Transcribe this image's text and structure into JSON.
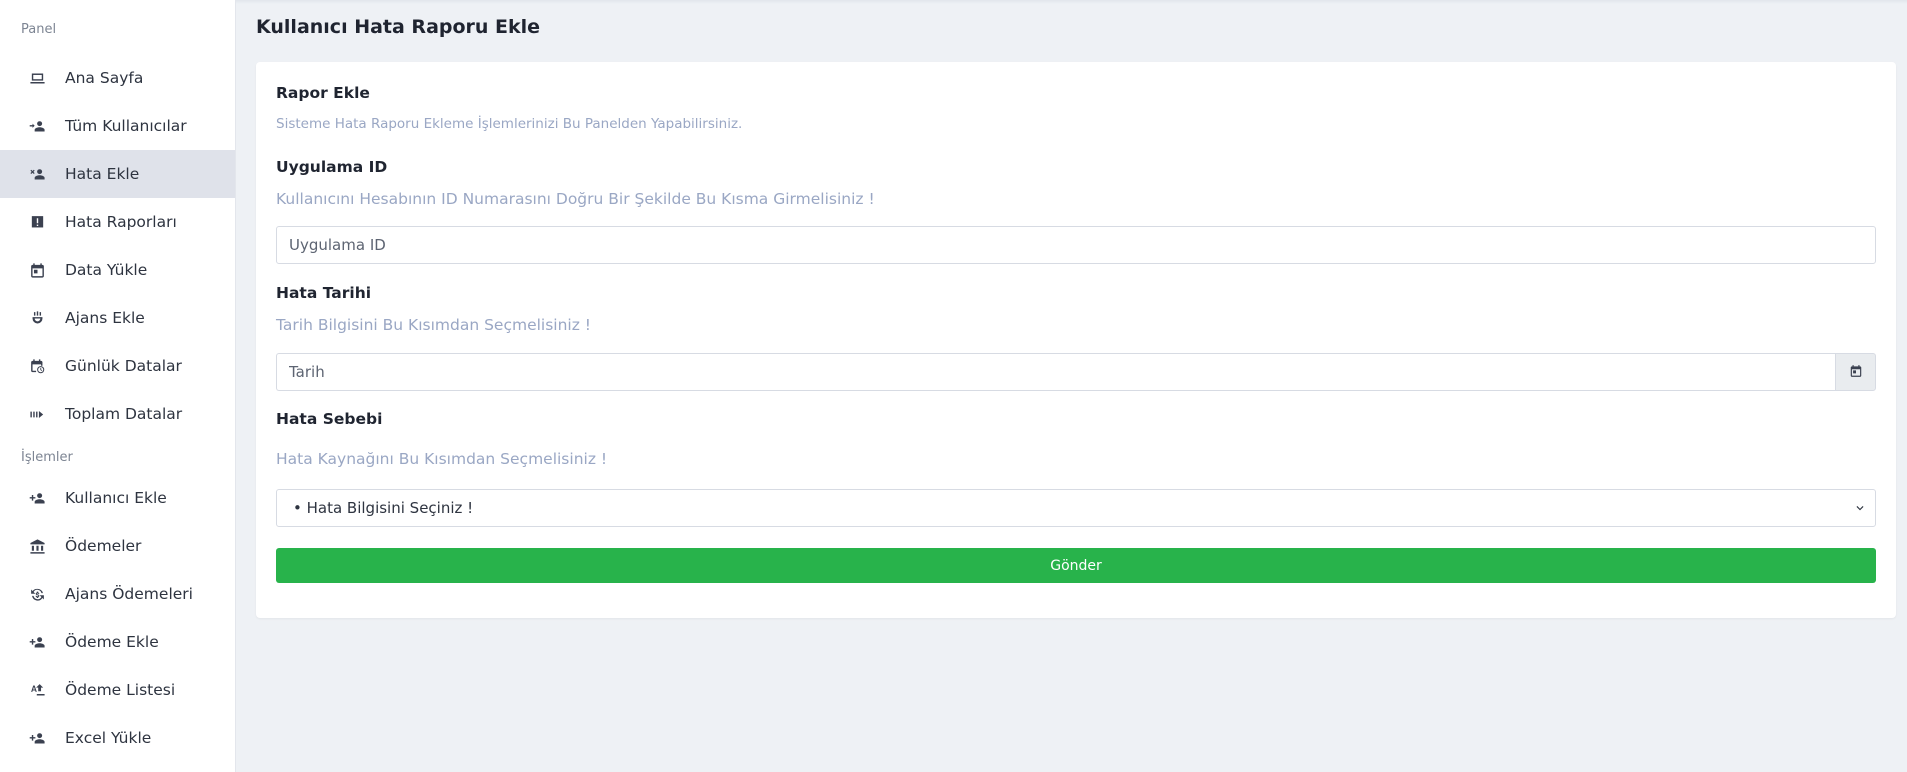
{
  "sidebar": {
    "section_panel": "Panel",
    "section_islemler": "İşlemler",
    "panel_items": [
      {
        "label": "Ana Sayfa",
        "icon": "laptop-icon"
      },
      {
        "label": "Tüm Kullanıcılar",
        "icon": "users-arrow-icon"
      },
      {
        "label": "Hata Ekle",
        "icon": "user-remove-icon",
        "active": true
      },
      {
        "label": "Hata Raporları",
        "icon": "report-icon"
      },
      {
        "label": "Data Yükle",
        "icon": "calendar-icon"
      },
      {
        "label": "Ajans Ekle",
        "icon": "agency-icon"
      },
      {
        "label": "Günlük Datalar",
        "icon": "calendar-clock-icon"
      },
      {
        "label": "Toplam Datalar",
        "icon": "arrow-right-icon"
      }
    ],
    "islem_items": [
      {
        "label": "Kullanıcı Ekle",
        "icon": "user-add-icon"
      },
      {
        "label": "Ödemeler",
        "icon": "bank-icon"
      },
      {
        "label": "Ajans Ödemeleri",
        "icon": "money-cycle-icon"
      },
      {
        "label": "Ödeme Ekle",
        "icon": "user-add-icon"
      },
      {
        "label": "Ödeme Listesi",
        "icon": "text-icon"
      },
      {
        "label": "Excel Yükle",
        "icon": "user-add-icon"
      }
    ]
  },
  "page": {
    "title": "Kullanıcı Hata Raporu Ekle"
  },
  "form": {
    "card_title": "Rapor Ekle",
    "card_subtitle": "Sisteme Hata Raporu Ekleme İşlemlerinizi Bu Panelden Yapabilirsiniz.",
    "app_id_label": "Uygulama ID",
    "app_id_hint": "Kullanıcını Hesabının ID Numarasını Doğru Bir Şekilde Bu Kısma Girmelisiniz !",
    "app_id_placeholder": "Uygulama ID",
    "date_label": "Hata Tarihi",
    "date_hint": "Tarih Bilgisini Bu Kısımdan Seçmelisiniz !",
    "date_placeholder": "Tarih",
    "reason_label": "Hata Sebebi",
    "reason_hint": "Hata Kaynağını Bu Kısımdan Seçmelisiniz !",
    "reason_selected": "• Hata Bilgisini Seçiniz !",
    "submit_label": "Gönder"
  },
  "colors": {
    "accent_green": "#28b34b",
    "hint_blue": "#9aa7c4",
    "active_bg": "#dfe2ea"
  }
}
